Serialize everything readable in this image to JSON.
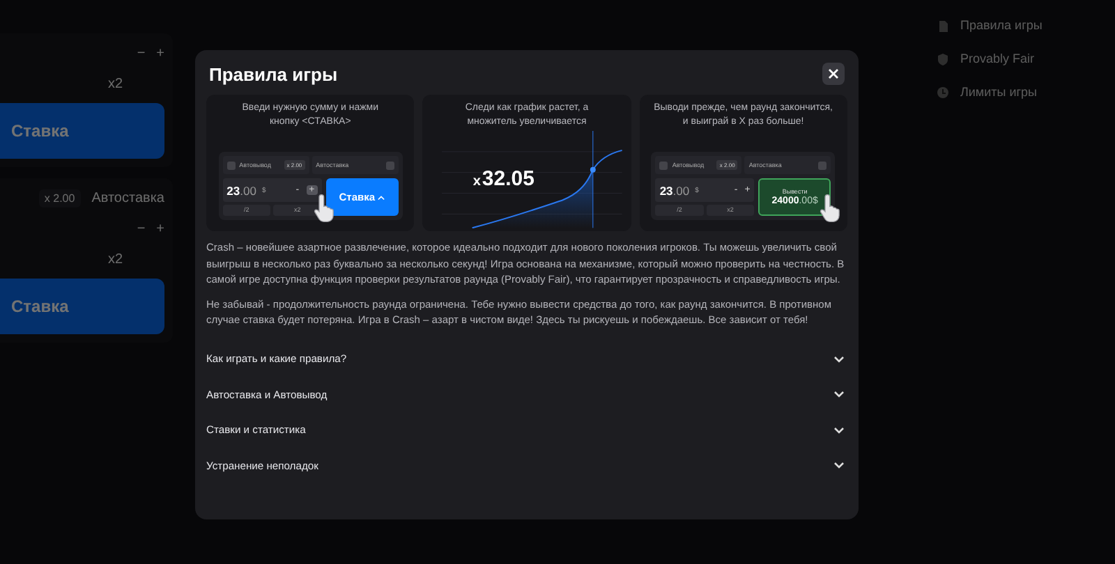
{
  "background": {
    "bet_panels": [
      {
        "minus": "−",
        "plus": "+",
        "double": "x2",
        "bet_button": "Ставка"
      },
      {
        "auto_cashout": "x 2.00",
        "autobet": "Автоставка",
        "minus": "−",
        "plus": "+",
        "double": "x2",
        "bet_button": "Ставка"
      }
    ],
    "menu": [
      {
        "label": "Правила игры"
      },
      {
        "label": "Provably Fair"
      },
      {
        "label": "Лимиты игры"
      }
    ]
  },
  "modal": {
    "title": "Правила игры",
    "cards": [
      {
        "kind": "bet",
        "caption": "Введи нужную сумму и нажми кнопку <СТАВКА>",
        "autocashout": "Автовывод",
        "multiplier": "x 2.00",
        "autobet": "Автоставка",
        "amount": "23",
        "amount_decimals": ".00",
        "currency": "$",
        "minus": "-",
        "plus": "+",
        "half": "/2",
        "double": "x2",
        "button": "Ставка"
      },
      {
        "kind": "chart",
        "caption": "Следи как график растет, а множитель увеличивается",
        "multiplier_prefix": "x",
        "multiplier": "32.05"
      },
      {
        "kind": "cashout",
        "caption": "Выводи прежде, чем раунд закончится, и выиграй в Х раз больше!",
        "autocashout": "Автовывод",
        "multiplier": "x 2.00",
        "autobet": "Автоставка",
        "amount": "23",
        "amount_decimals": ".00",
        "currency": "$",
        "minus": "-",
        "plus": "+",
        "half": "/2",
        "double": "x2",
        "button": "Вывести",
        "button_amount": "24000",
        "button_amount_decimals": ".00$"
      }
    ],
    "paragraphs": [
      "Crash – новейшее азартное развлечение, которое идеально подходит для нового поколения игроков. Ты можешь увеличить свой выигрыш в несколько раз буквально за несколько секунд! Игра основана на механизме, который можно проверить на честность. В самой игре доступна функция проверки результатов раунда (Provably Fair), что гарантирует прозрачность и справедливость игры.",
      "Не забывай - продолжительность раунда ограничена. Тебе нужно вывести средства до того, как раунд закончится. В противном случае ставка будет потеряна. Игра в Crash – азарт в чистом виде! Здесь ты рискуешь и побеждаешь. Все зависит от тебя!"
    ],
    "sections": [
      {
        "title": "Как играть и какие правила?",
        "expanded": false
      },
      {
        "title": "Автоставка и Автовывод",
        "expanded": false
      },
      {
        "title": "Ставки и статистика",
        "expanded": false
      },
      {
        "title": "Устранение неполадок",
        "expanded": false
      }
    ]
  }
}
